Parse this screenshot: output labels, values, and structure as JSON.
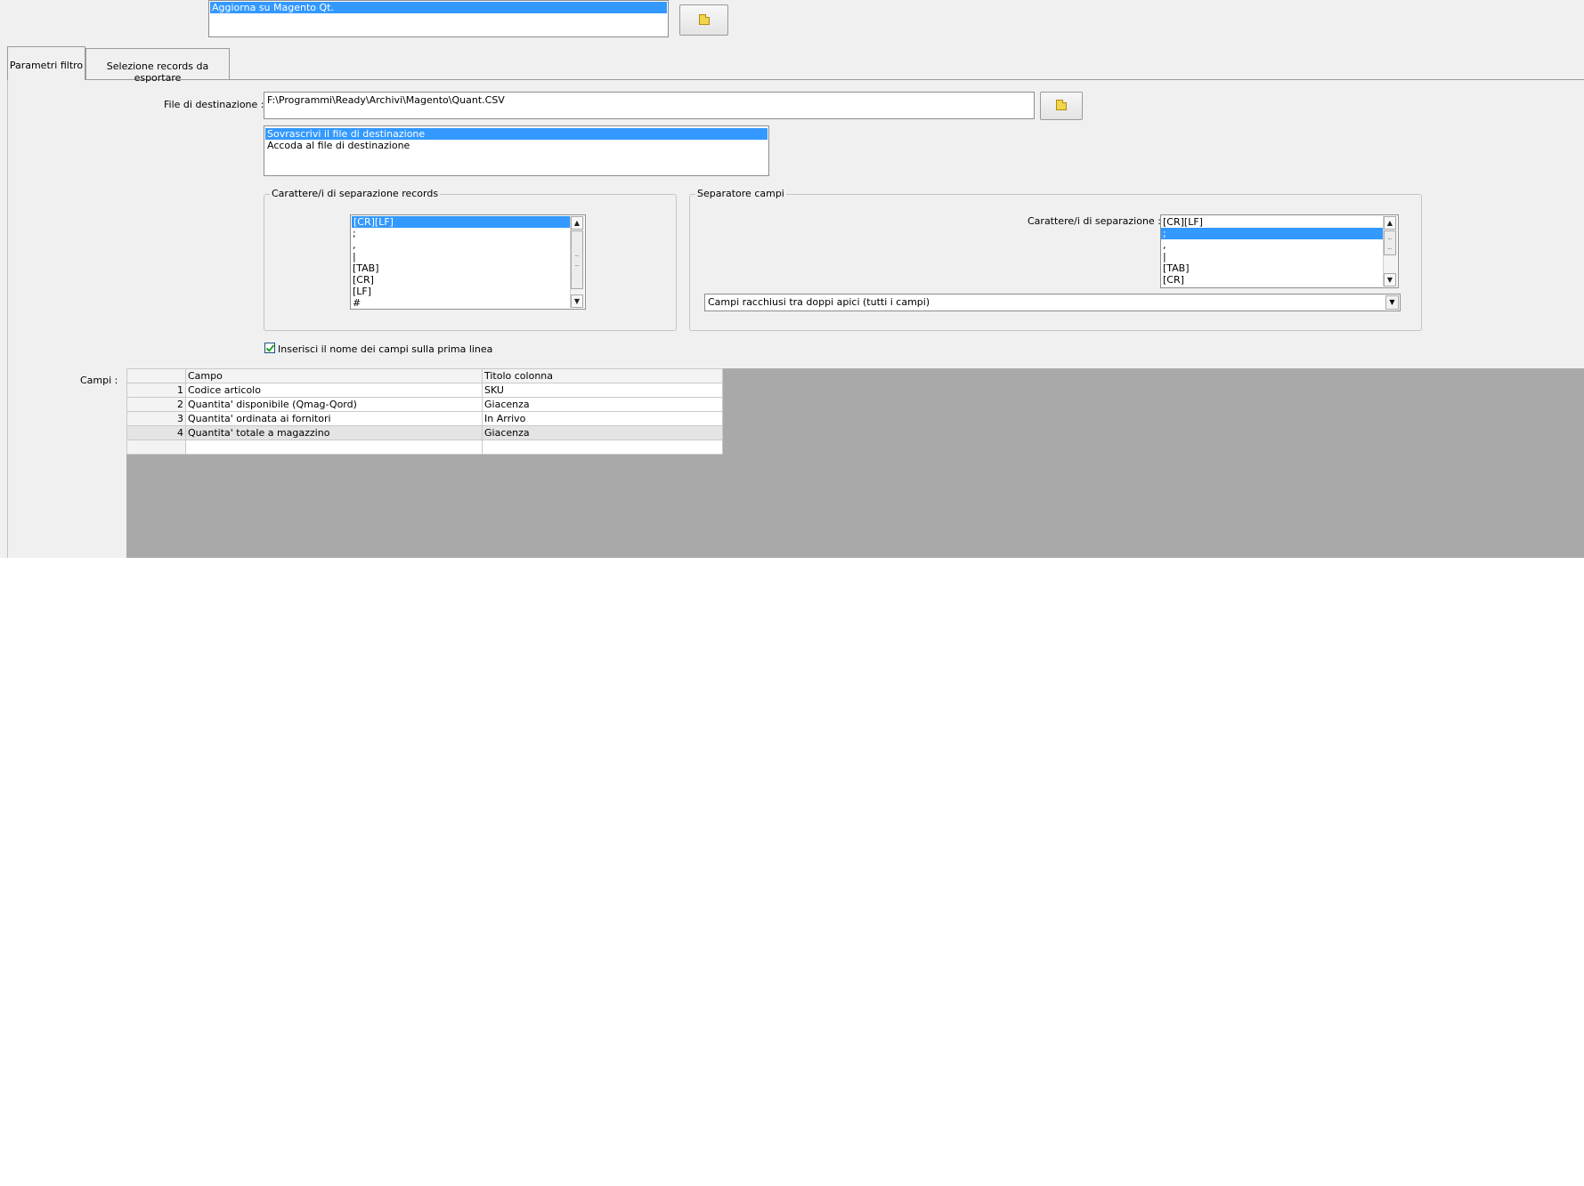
{
  "top": {
    "operation_list": [
      "Aggiorna su Magento Qt."
    ]
  },
  "tabs": [
    {
      "label": "Parametri filtro"
    },
    {
      "label": "Selezione records da esportare"
    }
  ],
  "destination": {
    "label": "File di destinazione :",
    "value": "F:\\Programmi\\Ready\\Archivi\\Magento\\Quant.CSV",
    "write_mode_options": [
      "Sovrascrivi il file di destinazione",
      "Accoda al file di destinazione"
    ]
  },
  "record_separator": {
    "title": "Carattere/i di separazione records",
    "options": [
      "[CR][LF]",
      ";",
      ",",
      "|",
      "[TAB]",
      "[CR]",
      "[LF]",
      "#"
    ]
  },
  "field_separator": {
    "title": "Separatore campi",
    "label": "Carattere/i di separazione :",
    "options": [
      "[CR][LF]",
      ";",
      ",",
      "|",
      "[TAB]",
      "[CR]"
    ],
    "quote_mode": "Campi racchiusi tra doppi apici (tutti i campi)"
  },
  "header_checkbox": {
    "label": "Inserisci il nome dei campi sulla prima linea",
    "checked": true
  },
  "fields": {
    "label": "Campi :",
    "columns": [
      "Campo",
      "Titolo colonna"
    ],
    "rows": [
      {
        "n": "1",
        "campo": "Codice articolo",
        "titolo": "SKU"
      },
      {
        "n": "2",
        "campo": "Quantita' disponibile (Qmag-Qord)",
        "titolo": "Giacenza"
      },
      {
        "n": "3",
        "campo": "Quantita' ordinata ai fornitori",
        "titolo": "In Arrivo"
      },
      {
        "n": "4",
        "campo": "Quantita' totale a magazzino",
        "titolo": "Giacenza"
      }
    ]
  },
  "colors": {
    "selection": "#3399ff",
    "window_bg": "#f0f0f0",
    "grid_area_bg": "#a9a9a9"
  }
}
